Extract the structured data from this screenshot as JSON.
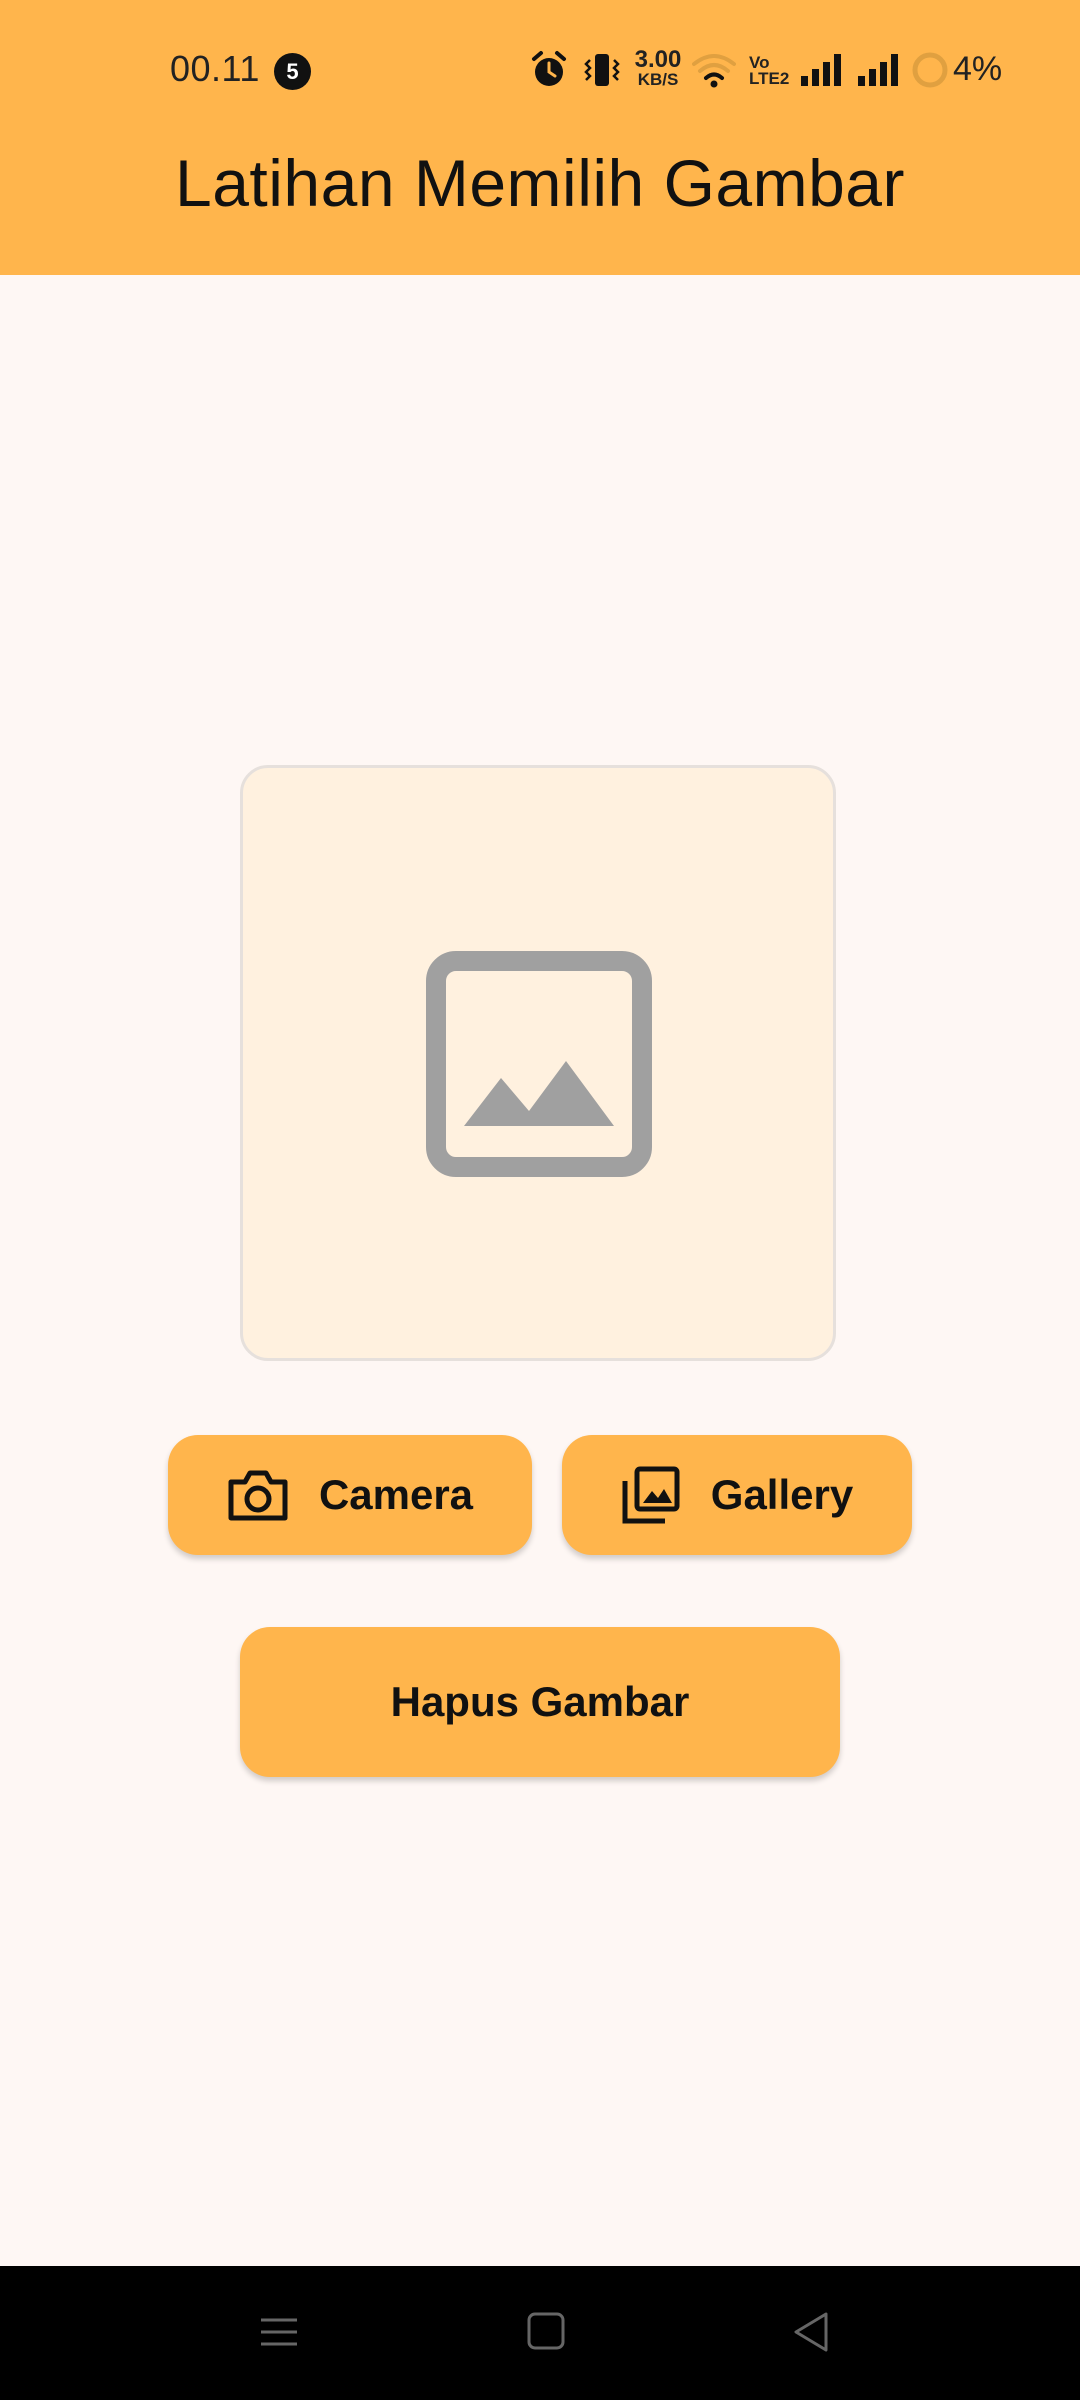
{
  "status_bar": {
    "time": "00.11",
    "notification_count": "5",
    "net_speed": "3.00",
    "net_speed_unit": "KB/S",
    "volte_top": "Vo",
    "volte_bottom": "LTE2",
    "battery": "4%"
  },
  "app_bar": {
    "title": "Latihan Memilih Gambar",
    "color": "#FFB54C"
  },
  "preview": {
    "icon": "image-placeholder-icon",
    "background": "#FFF1DF"
  },
  "buttons": {
    "camera_label": "Camera",
    "camera_icon": "camera-icon",
    "gallery_label": "Gallery",
    "gallery_icon": "gallery-icon",
    "hapus_label": "Hapus Gambar"
  },
  "nav_bar": {
    "recents_icon": "menu-icon",
    "home_icon": "home-icon",
    "back_icon": "back-icon"
  }
}
